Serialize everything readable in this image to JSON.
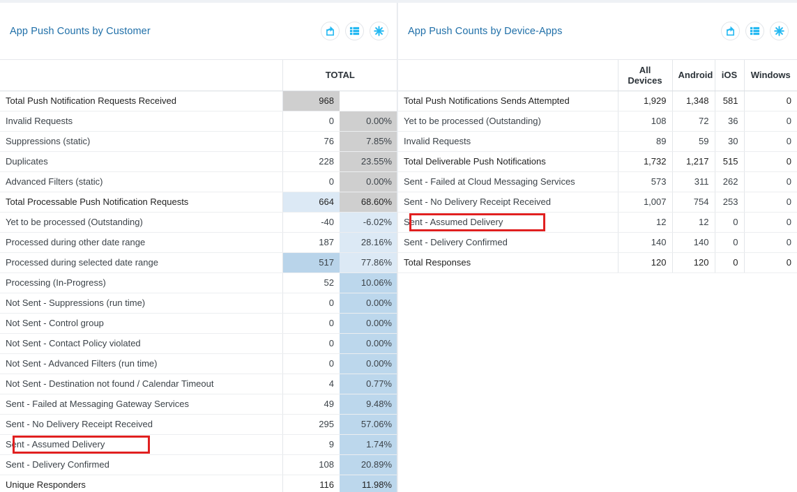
{
  "left_panel": {
    "title": "App Push Counts by Customer",
    "actions": [
      {
        "name": "export-icon",
        "label": "Export"
      },
      {
        "name": "list-view-icon",
        "label": "List View"
      },
      {
        "name": "snowflake-icon",
        "label": "Options"
      }
    ],
    "columns": [
      "",
      "TOTAL"
    ],
    "rows": [
      {
        "label": "Total Push Notification Requests Received",
        "level": 0,
        "value": "968",
        "pct": "",
        "value_shade": "sh-gray",
        "pct_shade": "sh-none",
        "bold": true,
        "highlight": false
      },
      {
        "label": "Invalid Requests",
        "level": 1,
        "value": "0",
        "pct": "0.00%",
        "value_shade": "sh-none",
        "pct_shade": "sh-gray",
        "bold": false,
        "highlight": false
      },
      {
        "label": "Suppressions (static)",
        "level": 1,
        "value": "76",
        "pct": "7.85%",
        "value_shade": "sh-none",
        "pct_shade": "sh-gray",
        "bold": false,
        "highlight": false
      },
      {
        "label": "Duplicates",
        "level": 1,
        "value": "228",
        "pct": "23.55%",
        "value_shade": "sh-none",
        "pct_shade": "sh-gray",
        "bold": false,
        "highlight": false
      },
      {
        "label": "Advanced Filters (static)",
        "level": 1,
        "value": "0",
        "pct": "0.00%",
        "value_shade": "sh-none",
        "pct_shade": "sh-gray",
        "bold": false,
        "highlight": false
      },
      {
        "label": "Total Processable Push Notification Requests",
        "level": 0,
        "value": "664",
        "pct": "68.60%",
        "value_shade": "sh-lblue",
        "pct_shade": "sh-gray",
        "bold": true,
        "highlight": false
      },
      {
        "label": "Yet to be processed (Outstanding)",
        "level": 2,
        "value": "-40",
        "pct": "-6.02%",
        "value_shade": "sh-none",
        "pct_shade": "sh-lblue",
        "bold": false,
        "highlight": false
      },
      {
        "label": "Processed during other date range",
        "level": 2,
        "value": "187",
        "pct": "28.16%",
        "value_shade": "sh-none",
        "pct_shade": "sh-lblue",
        "bold": false,
        "highlight": false
      },
      {
        "label": "Processed during selected date range",
        "level": 2,
        "value": "517",
        "pct": "77.86%",
        "value_shade": "sh-mblue",
        "pct_shade": "sh-lblue",
        "bold": false,
        "highlight": false
      },
      {
        "label": "Processing (In-Progress)",
        "level": 3,
        "value": "52",
        "pct": "10.06%",
        "value_shade": "sh-none",
        "pct_shade": "sh-bblue",
        "bold": false,
        "highlight": false
      },
      {
        "label": "Not Sent - Suppressions (run time)",
        "level": 3,
        "value": "0",
        "pct": "0.00%",
        "value_shade": "sh-none",
        "pct_shade": "sh-bblue",
        "bold": false,
        "highlight": false
      },
      {
        "label": "Not Sent - Control group",
        "level": 3,
        "value": "0",
        "pct": "0.00%",
        "value_shade": "sh-none",
        "pct_shade": "sh-bblue",
        "bold": false,
        "highlight": false
      },
      {
        "label": "Not Sent - Contact Policy violated",
        "level": 3,
        "value": "0",
        "pct": "0.00%",
        "value_shade": "sh-none",
        "pct_shade": "sh-bblue",
        "bold": false,
        "highlight": false
      },
      {
        "label": "Not Sent - Advanced Filters (run time)",
        "level": 3,
        "value": "0",
        "pct": "0.00%",
        "value_shade": "sh-none",
        "pct_shade": "sh-bblue",
        "bold": false,
        "highlight": false
      },
      {
        "label": "Not Sent - Destination not found / Calendar Timeout",
        "level": 3,
        "value": "4",
        "pct": "0.77%",
        "value_shade": "sh-none",
        "pct_shade": "sh-bblue",
        "bold": false,
        "highlight": false
      },
      {
        "label": "Sent - Failed at Messaging Gateway Services",
        "level": 3,
        "value": "49",
        "pct": "9.48%",
        "value_shade": "sh-none",
        "pct_shade": "sh-bblue",
        "bold": false,
        "highlight": false
      },
      {
        "label": "Sent - No Delivery Receipt Received",
        "level": 3,
        "value": "295",
        "pct": "57.06%",
        "value_shade": "sh-none",
        "pct_shade": "sh-bblue",
        "bold": false,
        "highlight": false
      },
      {
        "label": "Sent - Assumed Delivery",
        "level": 3,
        "value": "9",
        "pct": "1.74%",
        "value_shade": "sh-none",
        "pct_shade": "sh-bblue",
        "bold": false,
        "highlight": true
      },
      {
        "label": "Sent - Delivery Confirmed",
        "level": 3,
        "value": "108",
        "pct": "20.89%",
        "value_shade": "sh-none",
        "pct_shade": "sh-bblue",
        "bold": false,
        "highlight": false
      },
      {
        "label": "Unique Responders",
        "level": 0,
        "value": "116",
        "pct": "11.98%",
        "value_shade": "sh-none",
        "pct_shade": "sh-bblue",
        "bold": true,
        "highlight": false
      }
    ]
  },
  "right_panel": {
    "title": "App Push Counts by Device-Apps",
    "actions": [
      {
        "name": "export-icon",
        "label": "Export"
      },
      {
        "name": "list-view-icon",
        "label": "List View"
      },
      {
        "name": "snowflake-icon",
        "label": "Options"
      }
    ],
    "columns": [
      "",
      "All Devices",
      "Android",
      "iOS",
      "Windows"
    ],
    "rows": [
      {
        "label": "Total Push Notifications Sends Attempted",
        "level": 0,
        "all_devices": "1,929",
        "android": "1,348",
        "ios": "581",
        "windows": "0",
        "bold": true,
        "highlight": false
      },
      {
        "label": "Yet to be processed (Outstanding)",
        "level": 2,
        "all_devices": "108",
        "android": "72",
        "ios": "36",
        "windows": "0",
        "bold": false,
        "highlight": false
      },
      {
        "label": "Invalid Requests",
        "level": 1,
        "all_devices": "89",
        "android": "59",
        "ios": "30",
        "windows": "0",
        "bold": false,
        "highlight": false
      },
      {
        "label": "Total Deliverable Push Notifications",
        "level": 0,
        "all_devices": "1,732",
        "android": "1,217",
        "ios": "515",
        "windows": "0",
        "bold": true,
        "highlight": false
      },
      {
        "label": "Sent - Failed at Cloud Messaging Services",
        "level": 2,
        "all_devices": "573",
        "android": "311",
        "ios": "262",
        "windows": "0",
        "bold": false,
        "highlight": false
      },
      {
        "label": "Sent - No Delivery Receipt Received",
        "level": 2,
        "all_devices": "1,007",
        "android": "754",
        "ios": "253",
        "windows": "0",
        "bold": false,
        "highlight": false
      },
      {
        "label": "Sent - Assumed Delivery",
        "level": 2,
        "all_devices": "12",
        "android": "12",
        "ios": "0",
        "windows": "0",
        "bold": false,
        "highlight": true
      },
      {
        "label": "Sent - Delivery Confirmed",
        "level": 2,
        "all_devices": "140",
        "android": "140",
        "ios": "0",
        "windows": "0",
        "bold": false,
        "highlight": false
      },
      {
        "label": "Total Responses",
        "level": 0,
        "all_devices": "120",
        "android": "120",
        "ios": "0",
        "windows": "0",
        "bold": true,
        "highlight": false
      }
    ]
  },
  "colors": {
    "title": "#1f6fa8",
    "icon": "#25b9f2",
    "highlight": "#e02020",
    "shade_gray": "#cfcfcf",
    "shade_light_blue": "#dce9f5",
    "shade_mid_blue": "#b9d4ea"
  }
}
